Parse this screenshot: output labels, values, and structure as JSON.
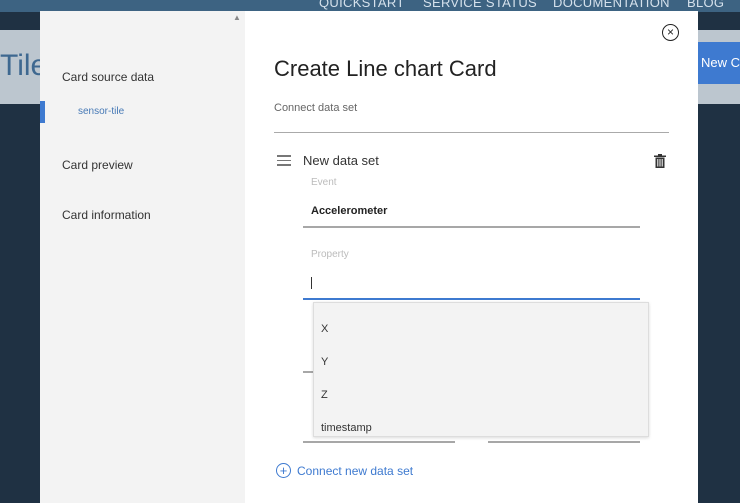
{
  "background": {
    "nav": [
      "QUICKSTART",
      "SERVICE STATUS",
      "DOCUMENTATION",
      "BLOG"
    ],
    "title_partial": "Tile",
    "new_card_partial": "New C"
  },
  "sidebar": {
    "items": [
      {
        "label": "Card source data"
      },
      {
        "label": "Card preview"
      },
      {
        "label": "Card information"
      }
    ],
    "sub_item": "sensor-tile"
  },
  "modal": {
    "title": "Create Line chart Card",
    "subtitle": "Connect data set",
    "close_icon": "close-icon"
  },
  "data_set": {
    "title": "New data set",
    "event_label": "Event",
    "event_value": "Accelerometer",
    "property_label": "Property",
    "property_value": ""
  },
  "dropdown_options": [
    "X",
    "Y",
    "Z",
    "timestamp"
  ],
  "connect_new": "Connect new data set"
}
